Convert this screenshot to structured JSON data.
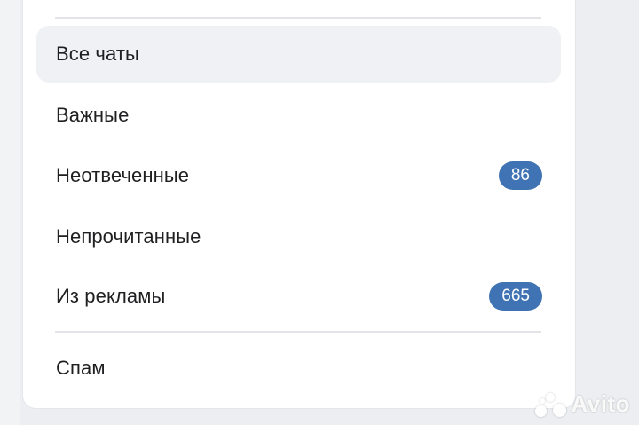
{
  "menu": {
    "items": [
      {
        "label": "Все чаты",
        "badge": null,
        "active": true
      },
      {
        "label": "Важные",
        "badge": null,
        "active": false
      },
      {
        "label": "Неотвеченные",
        "badge": "86",
        "active": false
      },
      {
        "label": "Непрочитанные",
        "badge": null,
        "active": false
      },
      {
        "label": "Из рекламы",
        "badge": "665",
        "active": false
      }
    ],
    "bottom_item": {
      "label": "Спам"
    }
  },
  "watermark": {
    "text": "Avito"
  },
  "colors": {
    "badge": "#3f73b4",
    "active_bg": "#f0f1f4",
    "text": "#1f1f21"
  }
}
